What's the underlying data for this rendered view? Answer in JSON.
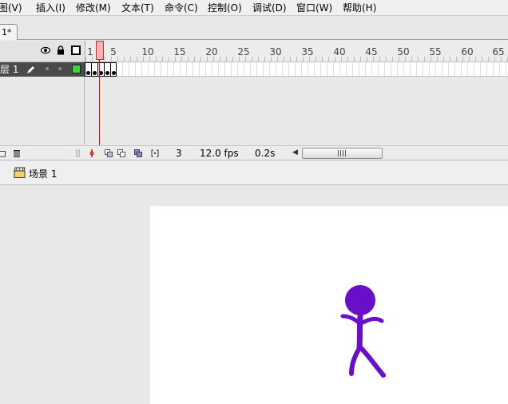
{
  "menu": [
    "图(V)",
    "插入(I)",
    "修改(M)",
    "文本(T)",
    "命令(C)",
    "控制(O)",
    "调试(D)",
    "窗口(W)",
    "帮助(H)"
  ],
  "document_tab": "1*",
  "timeline": {
    "ruler": [
      "1",
      "5",
      "10",
      "15",
      "20",
      "25",
      "30",
      "35",
      "40",
      "45",
      "50",
      "55",
      "60",
      "65"
    ],
    "layer_name": "层 1",
    "layer_color": "#3fd33f",
    "playhead_color": "#e00000",
    "status": {
      "current_frame": "3",
      "fps": "12.0 fps",
      "time": "0.2s",
      "scroll_grip": "III"
    }
  },
  "editbar": {
    "scene_label": "场景 1"
  },
  "stage": {
    "figure_color": "#6a0fc9"
  }
}
